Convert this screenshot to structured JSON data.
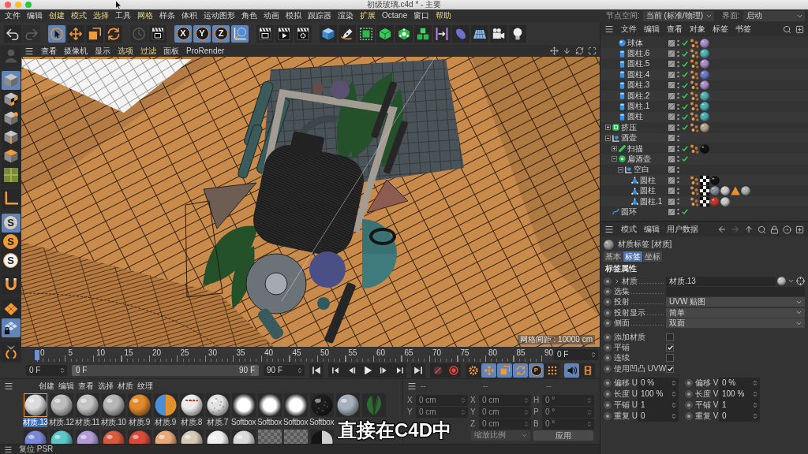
{
  "window": {
    "title": "初级玻璃.c4d * - 主要"
  },
  "menu_bar": [
    {
      "label": "文件",
      "highlighted": false
    },
    {
      "label": "编辑",
      "highlighted": false
    },
    {
      "label": "创建",
      "highlighted": true
    },
    {
      "label": "模式",
      "highlighted": true
    },
    {
      "label": "选择",
      "highlighted": true
    },
    {
      "label": "工具",
      "highlighted": false
    },
    {
      "label": "网格",
      "highlighted": true
    },
    {
      "label": "样条",
      "highlighted": false
    },
    {
      "label": "体积",
      "highlighted": false
    },
    {
      "label": "运动图形",
      "highlighted": false
    },
    {
      "label": "角色",
      "highlighted": false
    },
    {
      "label": "动画",
      "highlighted": false
    },
    {
      "label": "模拟",
      "highlighted": false
    },
    {
      "label": "跟踪器",
      "highlighted": false
    },
    {
      "label": "渲染",
      "highlighted": false
    },
    {
      "label": "扩展",
      "highlighted": true
    },
    {
      "label": "Octane",
      "highlighted": false
    },
    {
      "label": "窗口",
      "highlighted": false
    },
    {
      "label": "帮助",
      "highlighted": true
    }
  ],
  "node_space": {
    "label": "节点空间:",
    "value": "当前 (标准/物理)",
    "layout_label": "界面:",
    "layout_value": "启动"
  },
  "toolbar": [
    [
      {
        "kind": "undo",
        "active": false,
        "disabled": false
      },
      {
        "kind": "redo",
        "active": false,
        "disabled": true
      }
    ],
    [
      {
        "kind": "select",
        "active": true,
        "disabled": false
      },
      {
        "kind": "move",
        "active": false,
        "disabled": false
      },
      {
        "kind": "scale",
        "active": false,
        "disabled": false
      },
      {
        "kind": "rotate",
        "active": false,
        "disabled": false
      }
    ],
    [
      {
        "kind": "recent",
        "active": false,
        "disabled": true
      },
      {
        "kind": "render-region",
        "active": false,
        "disabled": false
      }
    ],
    [
      {
        "kind": "axis-lock",
        "label": "X",
        "active": true,
        "disabled": false
      },
      {
        "kind": "axis-lock",
        "label": "Y",
        "active": true,
        "disabled": false
      },
      {
        "kind": "axis-lock",
        "label": "Z",
        "active": true,
        "disabled": false
      },
      {
        "kind": "world",
        "active": true,
        "disabled": false
      }
    ],
    [
      {
        "kind": "render-view",
        "active": false,
        "disabled": false
      },
      {
        "kind": "render-picture",
        "active": false,
        "disabled": false
      },
      {
        "kind": "render-settings",
        "active": false,
        "disabled": false
      }
    ],
    [
      {
        "kind": "cube",
        "active": false,
        "disabled": false
      },
      {
        "kind": "pen",
        "active": false,
        "disabled": false
      },
      {
        "kind": "subdivide",
        "active": false,
        "disabled": false
      },
      {
        "kind": "extrude",
        "active": false,
        "disabled": false
      },
      {
        "kind": "cloner",
        "active": false,
        "disabled": false
      },
      {
        "kind": "cubes",
        "active": false,
        "disabled": false
      },
      {
        "kind": "deformer",
        "active": false,
        "disabled": false
      },
      {
        "kind": "field",
        "active": false,
        "disabled": false
      },
      {
        "kind": "floor",
        "active": false,
        "disabled": false
      },
      {
        "kind": "camera",
        "active": false,
        "disabled": false
      },
      {
        "kind": "light",
        "active": false,
        "disabled": false
      }
    ]
  ],
  "left_toolbar": [
    [
      {
        "kind": "faded",
        "active": false,
        "disabled": true
      }
    ],
    [
      {
        "kind": "model",
        "active": true,
        "disabled": false
      },
      {
        "kind": "texture",
        "active": false,
        "disabled": false
      },
      {
        "kind": "points",
        "active": false,
        "disabled": false
      },
      {
        "kind": "edges",
        "active": false,
        "disabled": false
      },
      {
        "kind": "polygons",
        "active": false,
        "disabled": false
      },
      {
        "kind": "uv",
        "active": false,
        "disabled": false
      }
    ],
    [
      {
        "kind": "axis",
        "active": false,
        "disabled": false
      }
    ],
    [
      {
        "kind": "snap-ring",
        "label": "S",
        "active": true,
        "disabled": false
      },
      {
        "kind": "snap-disc",
        "label": "S",
        "active": false,
        "disabled": false
      },
      {
        "kind": "snap-light",
        "label": "S",
        "active": false,
        "disabled": false
      }
    ],
    [
      {
        "kind": "magnet",
        "active": false,
        "disabled": false
      }
    ],
    [
      {
        "kind": "plane",
        "active": false,
        "disabled": false
      },
      {
        "kind": "grid-lock",
        "active": true,
        "disabled": false
      }
    ],
    [
      {
        "kind": "workplane",
        "active": false,
        "disabled": false
      }
    ]
  ],
  "viewport": {
    "menu": [
      {
        "label": "查看",
        "highlighted": false
      },
      {
        "label": "摄像机",
        "highlighted": false
      },
      {
        "label": "显示",
        "highlighted": false
      },
      {
        "label": "选项",
        "highlighted": true
      },
      {
        "label": "过滤",
        "highlighted": true
      },
      {
        "label": "面板",
        "highlighted": false
      },
      {
        "label": "ProRender",
        "highlighted": false
      }
    ],
    "grid_spacing": "网格间距 : 10000 cm"
  },
  "timeline": {
    "ticks": [
      "0",
      "5",
      "10",
      "15",
      "20",
      "25",
      "30",
      "35",
      "40",
      "45",
      "50",
      "55",
      "60",
      "65",
      "70",
      "75",
      "80",
      "85",
      "90"
    ],
    "level": 0,
    "current_frame": "0 F"
  },
  "transport": {
    "start": "0 F",
    "range": {
      "start": "0 F",
      "end": "90 F",
      "level": 1
    },
    "end": "90 F",
    "buttons": [
      [
        {
          "kind": "to-start",
          "active": false,
          "disabled": false
        }
      ],
      [
        {
          "kind": "prev-key",
          "active": false,
          "disabled": false
        },
        {
          "kind": "prev-frame",
          "active": false,
          "disabled": false
        },
        {
          "kind": "play",
          "active": false,
          "disabled": false
        },
        {
          "kind": "next-frame",
          "active": false,
          "disabled": false
        },
        {
          "kind": "next-key",
          "active": false,
          "disabled": false
        }
      ],
      [
        {
          "kind": "to-end",
          "active": false,
          "disabled": false
        }
      ],
      [
        {
          "kind": "record",
          "active": false,
          "disabled": true
        },
        {
          "kind": "autokey",
          "active": false,
          "disabled": false
        }
      ],
      [
        {
          "kind": "key-gear",
          "active": false,
          "disabled": false
        },
        {
          "kind": "key-move",
          "active": true,
          "disabled": false
        },
        {
          "kind": "key-scale",
          "active": true,
          "disabled": false
        },
        {
          "kind": "key-rotate",
          "active": true,
          "disabled": false
        },
        {
          "kind": "key-param",
          "label": "P",
          "active": true,
          "disabled": false
        },
        {
          "kind": "key-dots",
          "active": false,
          "disabled": false
        }
      ],
      [
        {
          "kind": "sound",
          "active": true,
          "disabled": false
        },
        {
          "kind": "film",
          "active": false,
          "disabled": false
        }
      ]
    ]
  },
  "material_manager": {
    "menu": [
      "创建",
      "编辑",
      "查看",
      "选择",
      "材质",
      "纹理"
    ],
    "rows": [
      [
        {
          "label": "材质.13",
          "kind": "sphere",
          "color": "#dcdcdc",
          "selected": true
        },
        {
          "label": "材质.12",
          "kind": "sphere",
          "color": "#bdbdbd",
          "selected": false
        },
        {
          "label": "材质.11",
          "kind": "sphere",
          "color": "#c3c3c3",
          "selected": false
        },
        {
          "label": "材质.10",
          "kind": "sphere",
          "color": "#b5b5b5",
          "selected": false
        },
        {
          "label": "材质.9",
          "kind": "sphere",
          "color": "#e08a2e",
          "selected": false
        },
        {
          "label": "材质.9",
          "kind": "split",
          "color": "#4a8fd6",
          "selected": false
        },
        {
          "label": "材质.8",
          "kind": "printed",
          "color": "#ebebeb",
          "selected": false
        },
        {
          "label": "材质.7",
          "kind": "speckled",
          "color": "#e2e2e2",
          "selected": false
        },
        {
          "label": "Softbox",
          "kind": "glow",
          "color": "#ffffff",
          "selected": false
        },
        {
          "label": "Softbox",
          "kind": "glow",
          "color": "#ffffff",
          "selected": false
        },
        {
          "label": "Softbox",
          "kind": "glow",
          "color": "#ffffff",
          "selected": false
        },
        {
          "label": "Softbox",
          "kind": "speckled",
          "color": "#1c1c1c",
          "selected": false
        },
        {
          "kind": "sphere",
          "color": "#a7b1bd",
          "selected": false
        },
        {
          "kind": "leaf",
          "color": "#2f6a30",
          "selected": false
        }
      ],
      [
        {
          "kind": "sphere",
          "color": "#7b88d6",
          "selected": false
        },
        {
          "kind": "sphere",
          "color": "#5ec6c6",
          "selected": false
        },
        {
          "kind": "sphere",
          "color": "#b39bd6",
          "selected": false
        },
        {
          "kind": "sphere",
          "color": "#d65a3c",
          "selected": false
        },
        {
          "kind": "sphere",
          "color": "#d84b3b",
          "selected": false
        },
        {
          "kind": "sphere",
          "color": "#e7a97a",
          "selected": false
        },
        {
          "kind": "sphere",
          "color": "#d6cab6",
          "selected": false
        },
        {
          "kind": "sphere",
          "color": "#efefef",
          "selected": false
        },
        {
          "kind": "sphere",
          "color": "#dadada",
          "selected": false
        },
        {
          "kind": "empty",
          "selected": false
        },
        {
          "kind": "empty",
          "selected": false
        },
        {
          "kind": "crescent",
          "color": "#cfcfcf",
          "selected": false
        }
      ]
    ]
  },
  "coordinates": {
    "headers": [
      "--",
      "--",
      "--"
    ],
    "disabled": true,
    "columns": [
      [
        {
          "axis": "X",
          "value": "0 cm"
        },
        {
          "axis": "Y",
          "value": "0 cm"
        }
      ],
      [
        {
          "axis": "X",
          "value": "0 cm"
        },
        {
          "axis": "Y",
          "value": "0 cm"
        },
        {
          "axis": "Z",
          "value": "0 cm"
        }
      ],
      [
        {
          "axis": "H",
          "value": "0 °"
        },
        {
          "axis": "P",
          "value": "0 °"
        },
        {
          "axis": "B",
          "value": "0 °"
        }
      ]
    ],
    "scale_mode": "缩放比例",
    "apply": "应用"
  },
  "status_bar": {
    "text": "复位 PSR"
  },
  "object_manager": {
    "menu": [
      "文件",
      "编辑",
      "查看",
      "对象",
      "标签",
      "书签"
    ],
    "objects": [
      {
        "children": [
          {
            "name": "球体",
            "kind": "sphere",
            "enabled": true,
            "tags": [
              {
                "kind": "phong"
              },
              {
                "kind": "material",
                "color": "#a98bc9"
              }
            ]
          },
          {
            "name": "圆柱.6",
            "kind": "cylinder",
            "enabled": true,
            "tags": [
              {
                "kind": "phong"
              },
              {
                "kind": "material",
                "color": "#4fb0b3"
              }
            ]
          },
          {
            "name": "圆柱.5",
            "kind": "cylinder",
            "enabled": true,
            "tags": [
              {
                "kind": "phong"
              },
              {
                "kind": "material",
                "color": "#a98bc9"
              }
            ]
          },
          {
            "name": "圆柱.4",
            "kind": "cylinder",
            "enabled": true,
            "tags": [
              {
                "kind": "phong"
              },
              {
                "kind": "material",
                "color": "#6f78c8"
              }
            ]
          },
          {
            "name": "圆柱.3",
            "kind": "cylinder",
            "enabled": true,
            "tags": [
              {
                "kind": "phong"
              },
              {
                "kind": "material",
                "color": "#a98bc9"
              }
            ]
          },
          {
            "name": "圆柱.2",
            "kind": "cylinder",
            "enabled": true,
            "tags": [
              {
                "kind": "phong"
              },
              {
                "kind": "material",
                "color": "#4fb0b3"
              }
            ]
          },
          {
            "name": "圆柱.1",
            "kind": "cylinder",
            "enabled": true,
            "tags": [
              {
                "kind": "phong"
              },
              {
                "kind": "material",
                "color": "#4fb0b3"
              }
            ]
          },
          {
            "name": "圆柱",
            "kind": "cylinder",
            "enabled": true,
            "tags": [
              {
                "kind": "phong"
              },
              {
                "kind": "material",
                "color": "#4fb0b3"
              }
            ]
          }
        ]
      },
      {
        "name": "挤压",
        "kind": "extrude",
        "expanded": false,
        "enabled": true,
        "tags": [
          {
            "kind": "phong"
          },
          {
            "kind": "material",
            "color": "#b5a38c"
          }
        ]
      },
      {
        "name": "酒壶",
        "kind": "null",
        "expanded": true,
        "children": [
          {
            "name": "扫描",
            "kind": "sweep",
            "expanded": false,
            "enabled": true,
            "tags": [
              {
                "kind": "phong"
              },
              {
                "kind": "material",
                "color": "#111111"
              }
            ]
          },
          {
            "name": "扁酒壶",
            "kind": "lathe",
            "expanded": true,
            "enabled": true,
            "children": [
              {
                "name": "空白",
                "kind": "null",
                "expanded": true,
                "children": [
                  {
                    "name": "圆柱",
                    "kind": "polygon",
                    "tags": [
                      {
                        "kind": "phong"
                      },
                      {
                        "kind": "uvw"
                      },
                      {
                        "kind": "material",
                        "color": "#151515"
                      }
                    ]
                  },
                  {
                    "name": "圆柱",
                    "kind": "polygon",
                    "tags": [
                      {
                        "kind": "phong"
                      },
                      {
                        "kind": "uvw"
                      },
                      {
                        "kind": "texture",
                        "color": "#8a949e"
                      },
                      {
                        "kind": "material",
                        "color": "#c8c8c8"
                      },
                      {
                        "kind": "warning"
                      },
                      {
                        "kind": "material",
                        "color": "#b0b0b0"
                      }
                    ]
                  },
                  {
                    "name": "圆柱.1",
                    "kind": "polygon",
                    "tags": [
                      {
                        "kind": "phong"
                      },
                      {
                        "kind": "uvw"
                      },
                      {
                        "kind": "material",
                        "color": "#c0392b"
                      },
                      {
                        "kind": "material",
                        "color": "#c8c8c8"
                      }
                    ]
                  }
                ]
              }
            ]
          }
        ]
      },
      {
        "name": "圆环",
        "kind": "spline",
        "enabled": true
      }
    ]
  },
  "attribute_manager": {
    "menu": [
      "模式",
      "编辑",
      "用户数据"
    ],
    "title": "材质标签 [材质]",
    "tabs": [
      {
        "label": "基本",
        "selected": false
      },
      {
        "label": "标签",
        "selected": true
      },
      {
        "label": "坐标",
        "selected": false
      }
    ],
    "section": "标签属性",
    "properties": [
      {
        "kind": "link",
        "label": "材质",
        "value": "材质.13"
      },
      {
        "kind": "text",
        "label": "选集"
      },
      {
        "kind": "dropdown",
        "label": "投射",
        "value": "UVW 贴图"
      },
      {
        "kind": "dropdown",
        "label": "投射显示",
        "value": "简单"
      },
      {
        "kind": "dropdown",
        "label": "侧面",
        "value": "双面"
      },
      {
        "kind": "checkbox",
        "label": "添加材质",
        "checked": false
      },
      {
        "kind": "checkbox",
        "label": "平铺",
        "checked": true
      },
      {
        "kind": "checkbox",
        "label": "连续",
        "checked": false
      },
      {
        "kind": "checkbox",
        "label": "使用凹凸 UVW",
        "checked": true
      }
    ],
    "pairs": [
      [
        {
          "label": "偏移 U",
          "value": "0 %"
        },
        {
          "label": "偏移 V",
          "value": "0 %"
        }
      ],
      [
        {
          "label": "长度 U",
          "value": "100 %"
        },
        {
          "label": "长度 V",
          "value": "100 %"
        }
      ],
      [
        {
          "label": "平铺 U",
          "value": "1"
        },
        {
          "label": "平铺 V",
          "value": "1"
        }
      ],
      [
        {
          "label": "重复 U",
          "value": "0"
        },
        {
          "label": "重复 V",
          "value": "0"
        }
      ]
    ]
  },
  "subtitle": "直接在C4D中"
}
